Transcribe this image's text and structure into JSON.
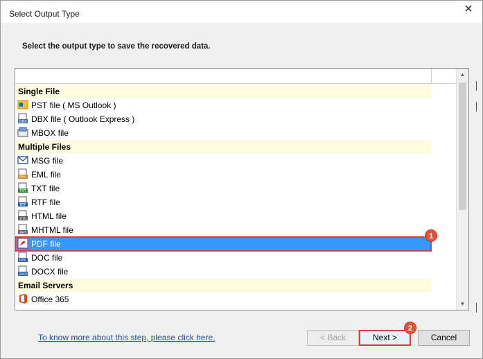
{
  "window": {
    "title": "Select Output Type",
    "close_glyph": "✕"
  },
  "instruction": "Select the output type to save the recovered data.",
  "list": {
    "rows": [
      {
        "kind": "group",
        "label": "Single File"
      },
      {
        "kind": "item",
        "label": "PST file ( MS Outlook )",
        "icon": "pst-icon"
      },
      {
        "kind": "item",
        "label": "DBX file ( Outlook Express )",
        "icon": "dbx-icon"
      },
      {
        "kind": "item",
        "label": "MBOX file",
        "icon": "mbox-icon"
      },
      {
        "kind": "group",
        "label": "Multiple Files"
      },
      {
        "kind": "item",
        "label": "MSG file",
        "icon": "msg-icon"
      },
      {
        "kind": "item",
        "label": "EML file",
        "icon": "eml-icon"
      },
      {
        "kind": "item",
        "label": "TXT file",
        "icon": "txt-icon"
      },
      {
        "kind": "item",
        "label": "RTF file",
        "icon": "rtf-icon"
      },
      {
        "kind": "item",
        "label": "HTML file",
        "icon": "html-icon"
      },
      {
        "kind": "item",
        "label": "MHTML file",
        "icon": "mhtml-icon"
      },
      {
        "kind": "item",
        "label": "PDF file",
        "icon": "pdf-icon",
        "selected": true
      },
      {
        "kind": "item",
        "label": "DOC file",
        "icon": "doc-icon"
      },
      {
        "kind": "item",
        "label": "DOCX file",
        "icon": "docx-icon"
      },
      {
        "kind": "group",
        "label": "Email Servers"
      },
      {
        "kind": "item",
        "label": "Office 365",
        "icon": "office365-icon"
      }
    ]
  },
  "scrollbar": {
    "up_glyph": "▲",
    "down_glyph": "▼"
  },
  "footer": {
    "help_link": "To know more about this step, please click here.",
    "back_label": "< Back",
    "next_label": "Next >",
    "cancel_label": "Cancel"
  },
  "annotations": {
    "badge_1": "1",
    "badge_2": "2"
  },
  "colors": {
    "selection": "#3399ff",
    "highlight_border": "#d93e3e",
    "group_background": "#fffbe0",
    "link": "#1a4fa3"
  }
}
